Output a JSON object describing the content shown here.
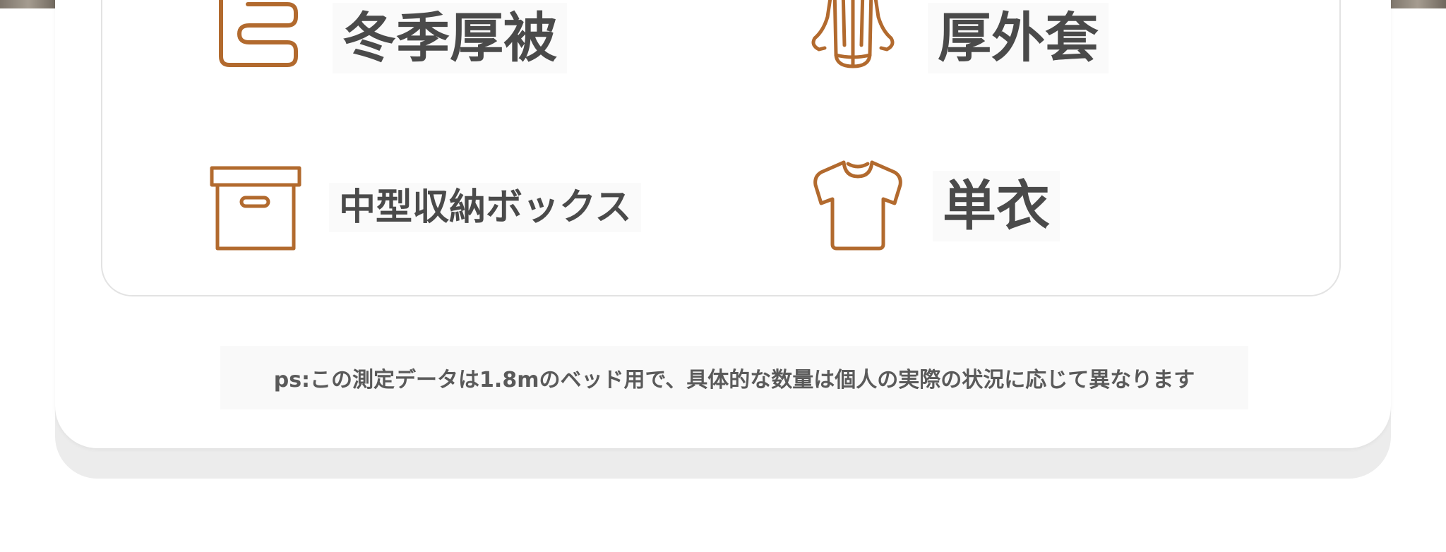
{
  "items": [
    {
      "icon": "folded-quilt-icon",
      "label": "冬季厚被"
    },
    {
      "icon": "coat-icon",
      "label": "厚外套"
    },
    {
      "icon": "storage-box-icon",
      "label": "中型収納ボックス"
    },
    {
      "icon": "t-shirt-icon",
      "label": "単衣"
    }
  ],
  "footnote": "ps:この測定データは1.8mのベッド用で、具体的な数量は個人の実際の状況に応じて異なります",
  "colors": {
    "icon_stroke": "#b26a2e",
    "text": "#4a4a4a",
    "card_border": "#e3e3e3"
  }
}
